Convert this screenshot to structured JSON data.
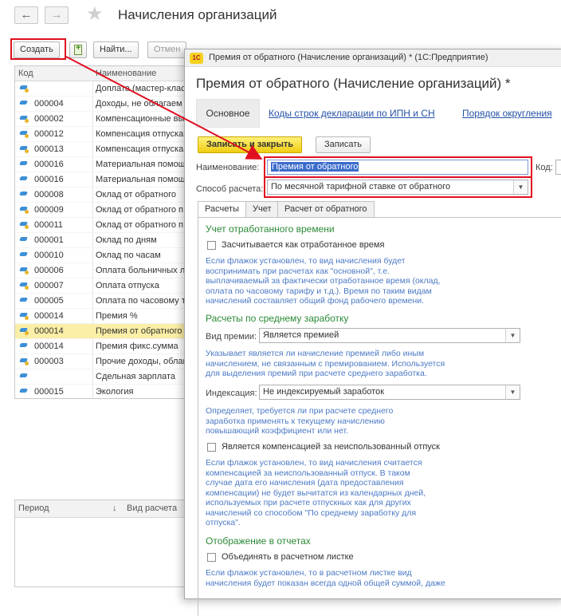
{
  "list_window": {
    "title": "Начисления организаций",
    "toolbar": {
      "create": "Создать",
      "find": "Найти...",
      "cancel": "Отмен"
    },
    "columns": {
      "code": "Код",
      "name": "Наименование"
    },
    "rows": [
      {
        "code": "",
        "name": "Доплата (мастер-клас",
        "icon": "dot"
      },
      {
        "code": "000004",
        "name": "Доходы, не облагаем",
        "icon": "plain"
      },
      {
        "code": "000002",
        "name": "Компенсационные вы",
        "icon": "dot"
      },
      {
        "code": "000012",
        "name": "Компенсация отпуска",
        "icon": "dot"
      },
      {
        "code": "000013",
        "name": "Компенсация отпуска",
        "icon": "dot"
      },
      {
        "code": "000016",
        "name": "Материальная помощ",
        "icon": "plain"
      },
      {
        "code": "000016",
        "name": "Материальная помощ",
        "icon": "plain"
      },
      {
        "code": "000008",
        "name": "Оклад от обратного",
        "icon": "plain"
      },
      {
        "code": "000009",
        "name": "Оклад от обратного п",
        "icon": "dot"
      },
      {
        "code": "000011",
        "name": "Оклад от обратного п",
        "icon": "dot"
      },
      {
        "code": "000001",
        "name": "Оклад по дням",
        "icon": "plain"
      },
      {
        "code": "000010",
        "name": "Оклад по часам",
        "icon": "plain"
      },
      {
        "code": "000006",
        "name": "Оплата больничных л",
        "icon": "dot"
      },
      {
        "code": "000007",
        "name": "Оплата отпуска",
        "icon": "dot"
      },
      {
        "code": "000005",
        "name": "Оплата по часовому т",
        "icon": "plain"
      },
      {
        "code": "000014",
        "name": "Премия %",
        "icon": "dot"
      },
      {
        "code": "000014",
        "name": "Премия от обратного",
        "icon": "dot",
        "selected": true
      },
      {
        "code": "000014",
        "name": "Премия фикс.сумма",
        "icon": "plain"
      },
      {
        "code": "000003",
        "name": "Прочие доходы, облаг",
        "icon": "dot"
      },
      {
        "code": "",
        "name": "Сдельная зарплата",
        "icon": "plain"
      },
      {
        "code": "000015",
        "name": "Экология",
        "icon": "plain"
      }
    ],
    "bottom_grid": {
      "period": "Период",
      "calc_type": "Вид расчета"
    }
  },
  "modal": {
    "window_title": "Премия от обратного (Начисление организаций) * (1С:Предприятие)",
    "logo": "1С",
    "title": "Премия от обратного (Начисление организаций) *",
    "tab_main": "Основное",
    "links": [
      "Коды строк декларации по ИПН и СН",
      "Порядок округления"
    ],
    "btn_save_close": "Записать и закрыть",
    "btn_save": "Записать",
    "name_label": "Наименование:",
    "name_value": "Премия от обратного",
    "code_label": "Код:",
    "method_label": "Способ расчета:",
    "method_value": "По месячной тарифной ставке от обратного",
    "subtabs": [
      "Расчеты",
      "Учет",
      "Расчет от обратного"
    ],
    "sec1_title": "Учет отработанного времени",
    "chk1_label": "Засчитывается как отработанное время",
    "hint1": "Если флажок установлен, то вид начисления будет\nвоспринимать при расчетах как \"основной\", т.е.\nвыплачиваемый за фактически отработанное время (оклад,\nоплата по часовому тарифу и т.д.). Время по таким видам\nначислений составляет общий фонд рабочего времени.",
    "sec2_title": "Расчеты по среднему заработку",
    "bonus_label": "Вид премии:",
    "bonus_value": "Является премией",
    "hint2": "Указывает является ли начисление премией либо иным\nначислением, не связанным с премированием. Используется\nдля выделения премий при расчете среднего заработка.",
    "index_label": "Индексация:",
    "index_value": "Не индексируемый заработок",
    "hint3": "Определяет, требуется ли при расчете среднего\nзаработка применять к текущему начислению\nповышающий коэффициент или нет.",
    "chk2_label": "Является компенсацией за неиспользованный отпуск",
    "hint4": "Если флажок установлен, то вид начисления считается\nкомпенсацией за неиспользованный отпуск. В таком\nслучае дата его начисления (дата предоставления\nкомпенсации) не будет вычитатся из календарных дней,\nиспользуемых при расчете отпускных как для других\nначислений со способом \"По среднему заработку для\nотпуска\".",
    "sec3_title": "Отображение в отчетах",
    "chk3_label": "Объединять в расчетном листке",
    "hint5": "Если флажок установлен, то в расчетном листке вид\nначисления будет показан всегда одной общей суммой, даже"
  },
  "colors": {
    "accent_red": "#e01020",
    "link_blue": "#2452a6",
    "hint_blue": "#4c7ac6",
    "section_green": "#2b8a36",
    "selected_row": "#fbeea6",
    "primary_button": "#f0cc10"
  }
}
